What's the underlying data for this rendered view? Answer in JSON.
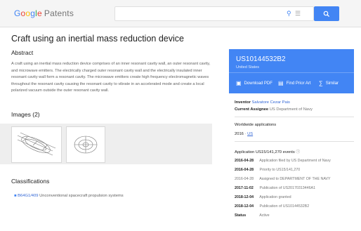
{
  "header": {
    "logo_google": [
      "G",
      "o",
      "o",
      "g",
      "l",
      "e"
    ],
    "logo_product": "Patents",
    "search_value": "",
    "search_icon": "search-icon",
    "pin_icon": "map-pin-icon",
    "grid_icon": "grid-icon"
  },
  "document": {
    "title": "Craft using an inertial mass reduction device",
    "abstract_heading": "Abstract",
    "abstract_text": "A craft using an inertial mass reduction device comprises of an inner resonant cavity wall, an outer resonant cavity, and microwave emitters. The electrically charged outer resonant cavity wall and the electrically insulated inner resonant cavity wall form a resonant cavity. The microwave emitters create high frequency electromagnetic waves throughout the resonant cavity causing the resonant cavity to vibrate in an accelerated mode and create a local polarized vacuum outside the outer resonant cavity wall.",
    "images_heading": "Images (2)",
    "classifications_heading": "Classifications",
    "classification_code": "B64G1/409",
    "classification_desc": "Unconventional spacecraft propulsion systems"
  },
  "sidebar": {
    "patent_number": "US10144532B2",
    "country": "United States",
    "actions": [
      "Download PDF",
      "Find Prior Art",
      "Similar"
    ],
    "inventor_label": "Inventor",
    "inventor_name": "Salvatore Cezar Pais",
    "assignee_label": "Current Assignee",
    "assignee_name": "US Department of Navy",
    "worldwide_label": "Worldwide applications",
    "worldwide_year": "2016",
    "worldwide_country": "US",
    "application_label": "Application US15/141,270 events",
    "events": [
      {
        "date": "2016-04-28",
        "desc": "Application filed by US Department of Navy"
      },
      {
        "date": "2016-04-28",
        "desc": "Priority to US15/141,270"
      },
      {
        "date": "2016-04-28",
        "desc": "Assigned to DEPARTMENT OF THE NAVY"
      },
      {
        "date": "2017-11-02",
        "desc": "Publication of US20170313446A1"
      },
      {
        "date": "2018-12-04",
        "desc": "Application granted"
      },
      {
        "date": "2018-12-04",
        "desc": "Publication of US10144532B2"
      },
      {
        "date": "Status",
        "desc": "Active"
      }
    ]
  },
  "colors": {
    "accent": "#4285f4",
    "link": "#3367d6"
  }
}
